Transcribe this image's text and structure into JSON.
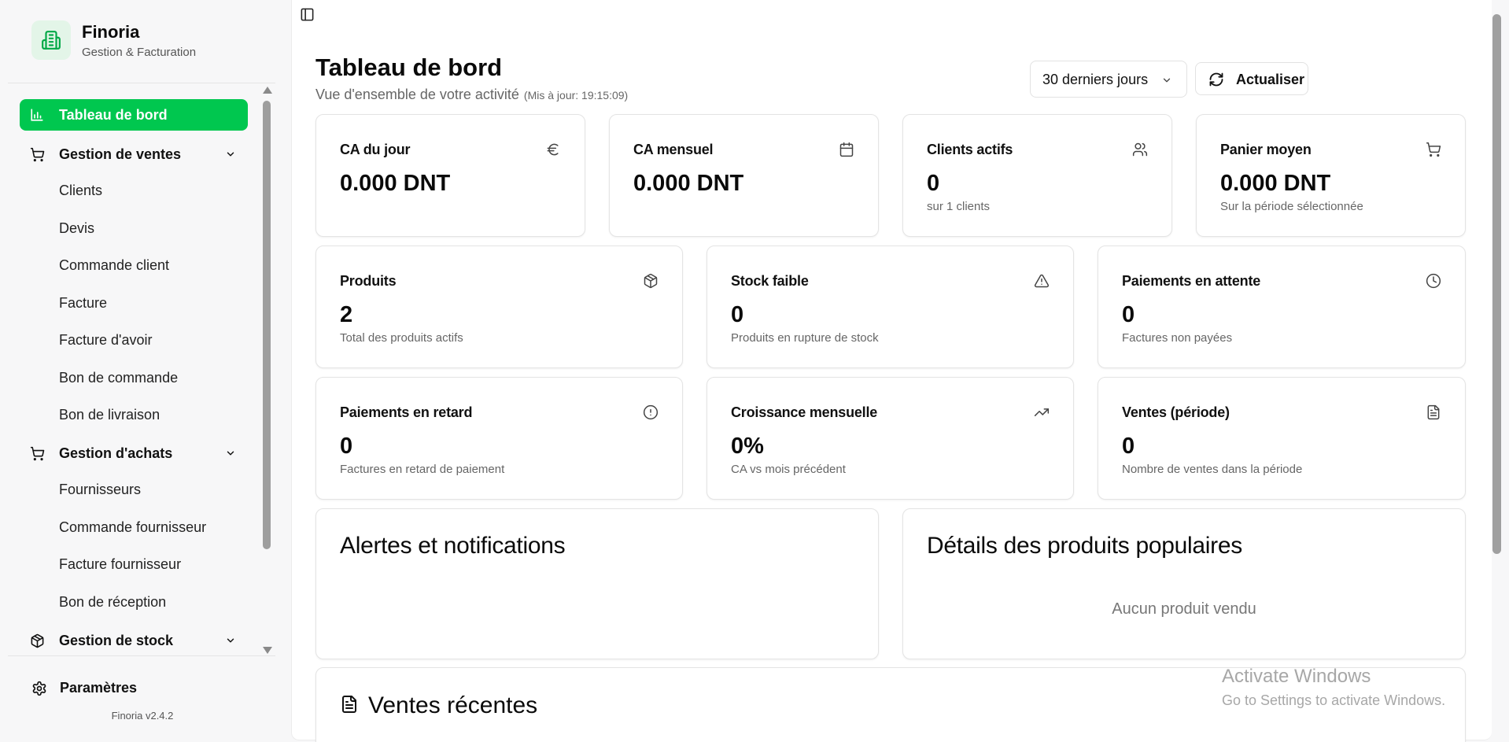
{
  "brand": {
    "name": "Finoria",
    "subtitle": "Gestion & Facturation"
  },
  "colors": {
    "accent": "#00c74f",
    "accent_soft": "#e3f5e8"
  },
  "nav": {
    "dashboard": "Tableau de bord",
    "sales": {
      "label": "Gestion de ventes",
      "items": [
        "Clients",
        "Devis",
        "Commande client",
        "Facture",
        "Facture d'avoir",
        "Bon de commande",
        "Bon de livraison"
      ]
    },
    "purchases": {
      "label": "Gestion d'achats",
      "items": [
        "Fournisseurs",
        "Commande fournisseur",
        "Facture fournisseur",
        "Bon de réception"
      ]
    },
    "stock": {
      "label": "Gestion de stock"
    }
  },
  "settings_label": "Paramètres",
  "version": "Finoria v2.4.2",
  "header": {
    "title": "Tableau de bord",
    "subtitle": "Vue d'ensemble de votre activité",
    "updated": "(Mis à jour: 19:15:09)",
    "period": "30 derniers jours",
    "refresh": "Actualiser"
  },
  "stats_row1": [
    {
      "title": "CA du jour",
      "value": "0.000 DNT",
      "sub": "",
      "icon": "euro-icon"
    },
    {
      "title": "CA mensuel",
      "value": "0.000 DNT",
      "sub": "",
      "icon": "calendar-icon"
    },
    {
      "title": "Clients actifs",
      "value": "0",
      "sub": "sur 1 clients",
      "icon": "users-icon"
    },
    {
      "title": "Panier moyen",
      "value": "0.000 DNT",
      "sub": "Sur la période sélectionnée",
      "icon": "cart-icon"
    }
  ],
  "stats_row2": [
    {
      "title": "Produits",
      "value": "2",
      "sub": "Total des produits actifs",
      "icon": "package-icon"
    },
    {
      "title": "Stock faible",
      "value": "0",
      "sub": "Produits en rupture de stock",
      "icon": "alert-triangle-icon"
    },
    {
      "title": "Paiements en attente",
      "value": "0",
      "sub": "Factures non payées",
      "icon": "clock-icon"
    }
  ],
  "stats_row3": [
    {
      "title": "Paiements en retard",
      "value": "0",
      "sub": "Factures en retard de paiement",
      "icon": "alert-circle-icon"
    },
    {
      "title": "Croissance mensuelle",
      "value": "0%",
      "sub": "CA vs mois précédent",
      "icon": "trending-up-icon"
    },
    {
      "title": "Ventes (période)",
      "value": "0",
      "sub": "Nombre de ventes dans la période",
      "icon": "file-text-icon"
    }
  ],
  "alerts": {
    "title": "Alertes et notifications"
  },
  "popular": {
    "title": "Détails des produits populaires",
    "empty": "Aucun produit vendu"
  },
  "recent": {
    "title": "Ventes récentes"
  },
  "windows": {
    "line1": "Activate Windows",
    "line2": "Go to Settings to activate Windows."
  }
}
